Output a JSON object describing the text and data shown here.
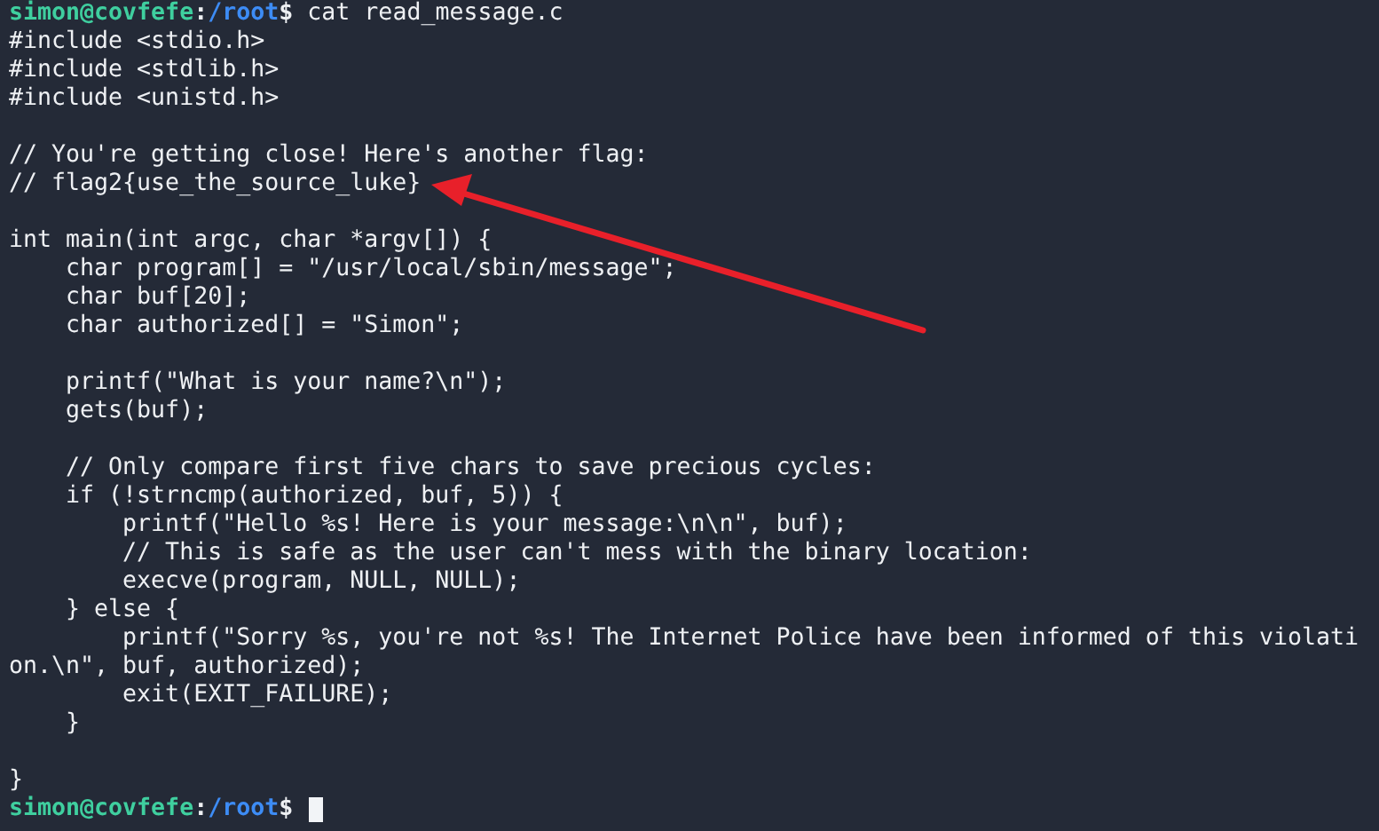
{
  "terminal": {
    "lines": [
      {
        "kind": "prompt",
        "user_host": "simon@covfefe",
        "separator": ":",
        "path": "/root",
        "symbol": "$",
        "command": "cat read_message.c"
      },
      {
        "kind": "text",
        "text": "#include <stdio.h>"
      },
      {
        "kind": "text",
        "text": "#include <stdlib.h>"
      },
      {
        "kind": "text",
        "text": "#include <unistd.h>"
      },
      {
        "kind": "blank"
      },
      {
        "kind": "text",
        "text": "// You're getting close! Here's another flag:"
      },
      {
        "kind": "text",
        "text": "// flag2{use_the_source_luke}"
      },
      {
        "kind": "blank"
      },
      {
        "kind": "text",
        "text": "int main(int argc, char *argv[]) {"
      },
      {
        "kind": "text",
        "text": "    char program[] = \"/usr/local/sbin/message\";"
      },
      {
        "kind": "text",
        "text": "    char buf[20];"
      },
      {
        "kind": "text",
        "text": "    char authorized[] = \"Simon\";"
      },
      {
        "kind": "blank"
      },
      {
        "kind": "text",
        "text": "    printf(\"What is your name?\\n\");"
      },
      {
        "kind": "text",
        "text": "    gets(buf);"
      },
      {
        "kind": "blank"
      },
      {
        "kind": "text",
        "text": "    // Only compare first five chars to save precious cycles:"
      },
      {
        "kind": "text",
        "text": "    if (!strncmp(authorized, buf, 5)) {"
      },
      {
        "kind": "text",
        "text": "        printf(\"Hello %s! Here is your message:\\n\\n\", buf);"
      },
      {
        "kind": "text",
        "text": "        // This is safe as the user can't mess with the binary location:"
      },
      {
        "kind": "text",
        "text": "        execve(program, NULL, NULL);"
      },
      {
        "kind": "text",
        "text": "    } else {"
      },
      {
        "kind": "text",
        "text": "        printf(\"Sorry %s, you're not %s! The Internet Police have been informed of this violati"
      },
      {
        "kind": "text",
        "text": "on.\\n\", buf, authorized);"
      },
      {
        "kind": "text",
        "text": "        exit(EXIT_FAILURE);"
      },
      {
        "kind": "text",
        "text": "    }"
      },
      {
        "kind": "blank"
      },
      {
        "kind": "text",
        "text": "}"
      },
      {
        "kind": "prompt",
        "user_host": "simon@covfefe",
        "separator": ":",
        "path": "/root",
        "symbol": "$",
        "cursor": true
      }
    ]
  }
}
